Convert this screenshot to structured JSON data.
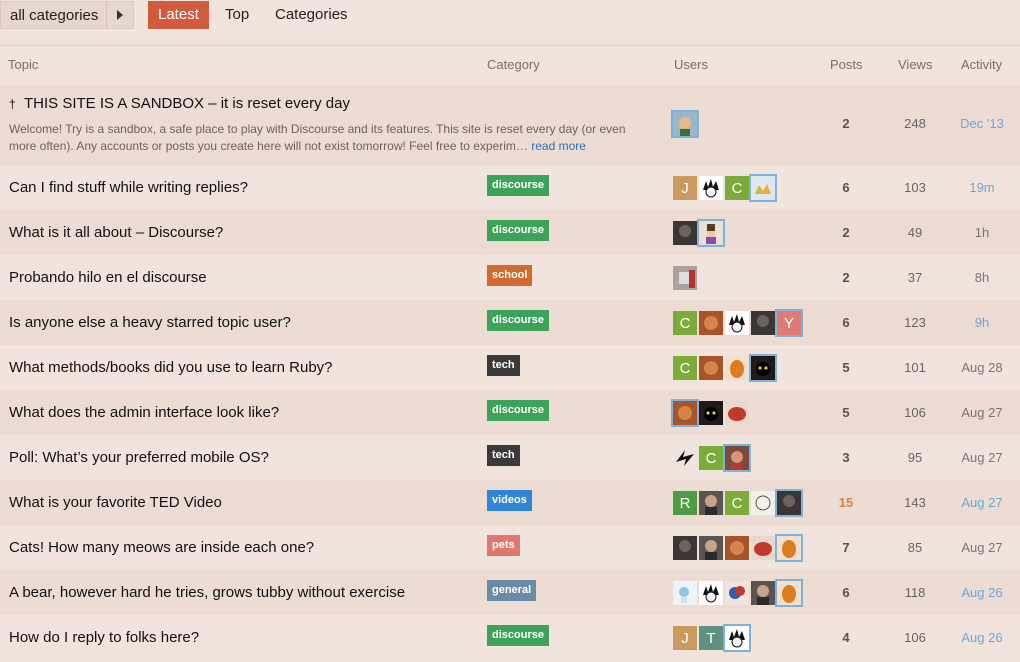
{
  "nav": {
    "category_select": "all categories",
    "tabs": [
      "Latest",
      "Top",
      "Categories"
    ]
  },
  "columns": {
    "topic": "Topic",
    "category": "Category",
    "users": "Users",
    "posts": "Posts",
    "views": "Views",
    "activity": "Activity"
  },
  "colors": {
    "discourse": "#3ea35a",
    "school": "#cf6b2f",
    "tech": "#3a3a3a",
    "videos": "#2f86d6",
    "pets": "#e0786f",
    "general": "#6a8aa6",
    "accent": "#d25a3e"
  },
  "topics": [
    {
      "title": "THIS SITE IS A SANDBOX – it is reset every day",
      "pinned": true,
      "excerpt": "Welcome! Try is a sandbox, a safe place to play with Discourse and its features. This site is reset every day (or even more often). Any accounts or posts you create here will not exist tomorrow! Feel free to experim…",
      "read_more": "read more",
      "category": "",
      "avatars": [
        "face-man"
      ],
      "posts": "2",
      "views": "248",
      "activity": "Dec '13"
    },
    {
      "title": "Can I find stuff while writing replies?",
      "category": "discourse",
      "avatars": [
        "J",
        "spiky",
        "C",
        "crown"
      ],
      "posts": "6",
      "views": "103",
      "activity": "19m"
    },
    {
      "title": "What is it all about – Discourse?",
      "category": "discourse",
      "avatars": [
        "dark-photo",
        "pixel-char"
      ],
      "posts": "2",
      "views": "49",
      "activity": "1h"
    },
    {
      "title": "Probando hilo en el discourse",
      "category": "school",
      "avatars": [
        "grey-photo"
      ],
      "posts": "2",
      "views": "37",
      "activity": "8h"
    },
    {
      "title": "Is anyone else a heavy starred topic user?",
      "category": "discourse",
      "avatars": [
        "C",
        "orange-photo",
        "spiky",
        "dark-photo",
        "Y"
      ],
      "posts": "6",
      "views": "123",
      "activity": "9h"
    },
    {
      "title": "What methods/books did you use to learn Ruby?",
      "category": "tech",
      "avatars": [
        "C",
        "orange-photo",
        "amber-egg",
        "black-cat"
      ],
      "posts": "5",
      "views": "101",
      "activity": "Aug 28"
    },
    {
      "title": "What does the admin interface look like?",
      "category": "discourse",
      "avatars": [
        "orange-photo",
        "black-cat",
        "red-bird"
      ],
      "posts": "5",
      "views": "106",
      "activity": "Aug 27"
    },
    {
      "title": "Poll: What’s your preferred mobile OS?",
      "category": "tech",
      "avatars": [
        "bolt",
        "C",
        "face-red"
      ],
      "posts": "3",
      "views": "95",
      "activity": "Aug 27"
    },
    {
      "title": "What is your favorite TED Video",
      "category": "videos",
      "avatars": [
        "R",
        "face-dark",
        "C",
        "sketch-face",
        "dark-photo"
      ],
      "posts": "15",
      "views": "143",
      "activity": "Aug 27"
    },
    {
      "title": "Cats! How many meows are inside each one?",
      "category": "pets",
      "avatars": [
        "dark-photo",
        "face-dark",
        "orange-photo",
        "red-bird",
        "amber-egg"
      ],
      "posts": "7",
      "views": "85",
      "activity": "Aug 27"
    },
    {
      "title": "A bear, however hard he tries, grows tubby without exercise",
      "category": "general",
      "avatars": [
        "cartoon-blue",
        "spiky",
        "globe",
        "face-dark",
        "amber-egg"
      ],
      "posts": "6",
      "views": "118",
      "activity": "Aug 26"
    },
    {
      "title": "How do I reply to folks here?",
      "category": "discourse",
      "avatars": [
        "J",
        "T",
        "spiky"
      ],
      "posts": "4",
      "views": "106",
      "activity": "Aug 26"
    }
  ]
}
